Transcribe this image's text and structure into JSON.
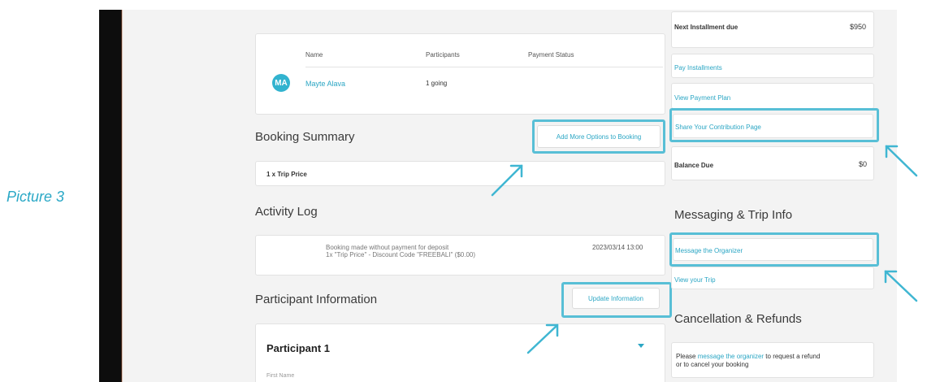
{
  "caption": "Picture 3",
  "participants_table": {
    "headers": [
      "Name",
      "Participants",
      "Payment Status"
    ],
    "rows": [
      {
        "initials": "MA",
        "name": "Mayte Alava",
        "participants": "1 going",
        "payment_status": ""
      }
    ]
  },
  "booking_summary": {
    "title": "Booking Summary",
    "add_options_label": "Add More Options to Booking",
    "line_item": "1 x Trip Price"
  },
  "activity_log": {
    "title": "Activity Log",
    "entry_line1": "Booking made without payment for deposit",
    "entry_line2": "1x \"Trip Price\" - Discount Code \"FREEBALI\" ($0.00)",
    "entry_date": "2023/03/14 13:00"
  },
  "participant_info": {
    "title": "Participant Information",
    "update_label": "Update Information",
    "participant_heading": "Participant 1",
    "first_name_label": "First Name"
  },
  "payments": {
    "next_installment_label": "Next Installment due",
    "next_installment_value": "$950",
    "pay_installments": "Pay Installments",
    "view_payment_plan": "View Payment Plan",
    "share_contribution": "Share Your Contribution Page",
    "balance_due_label": "Balance Due",
    "balance_due_value": "$0"
  },
  "messaging": {
    "title": "Messaging & Trip Info",
    "message_organizer": "Message the Organizer",
    "view_trip": "View your Trip"
  },
  "cancellation": {
    "title": "Cancellation & Refunds",
    "text_before": "Please ",
    "link_text": "message the organizer",
    "text_after": " to request a refund or to cancel your booking"
  },
  "colors": {
    "accent": "#2ba6c4",
    "highlight": "#58bfd6",
    "background": "#f3f3f3"
  }
}
